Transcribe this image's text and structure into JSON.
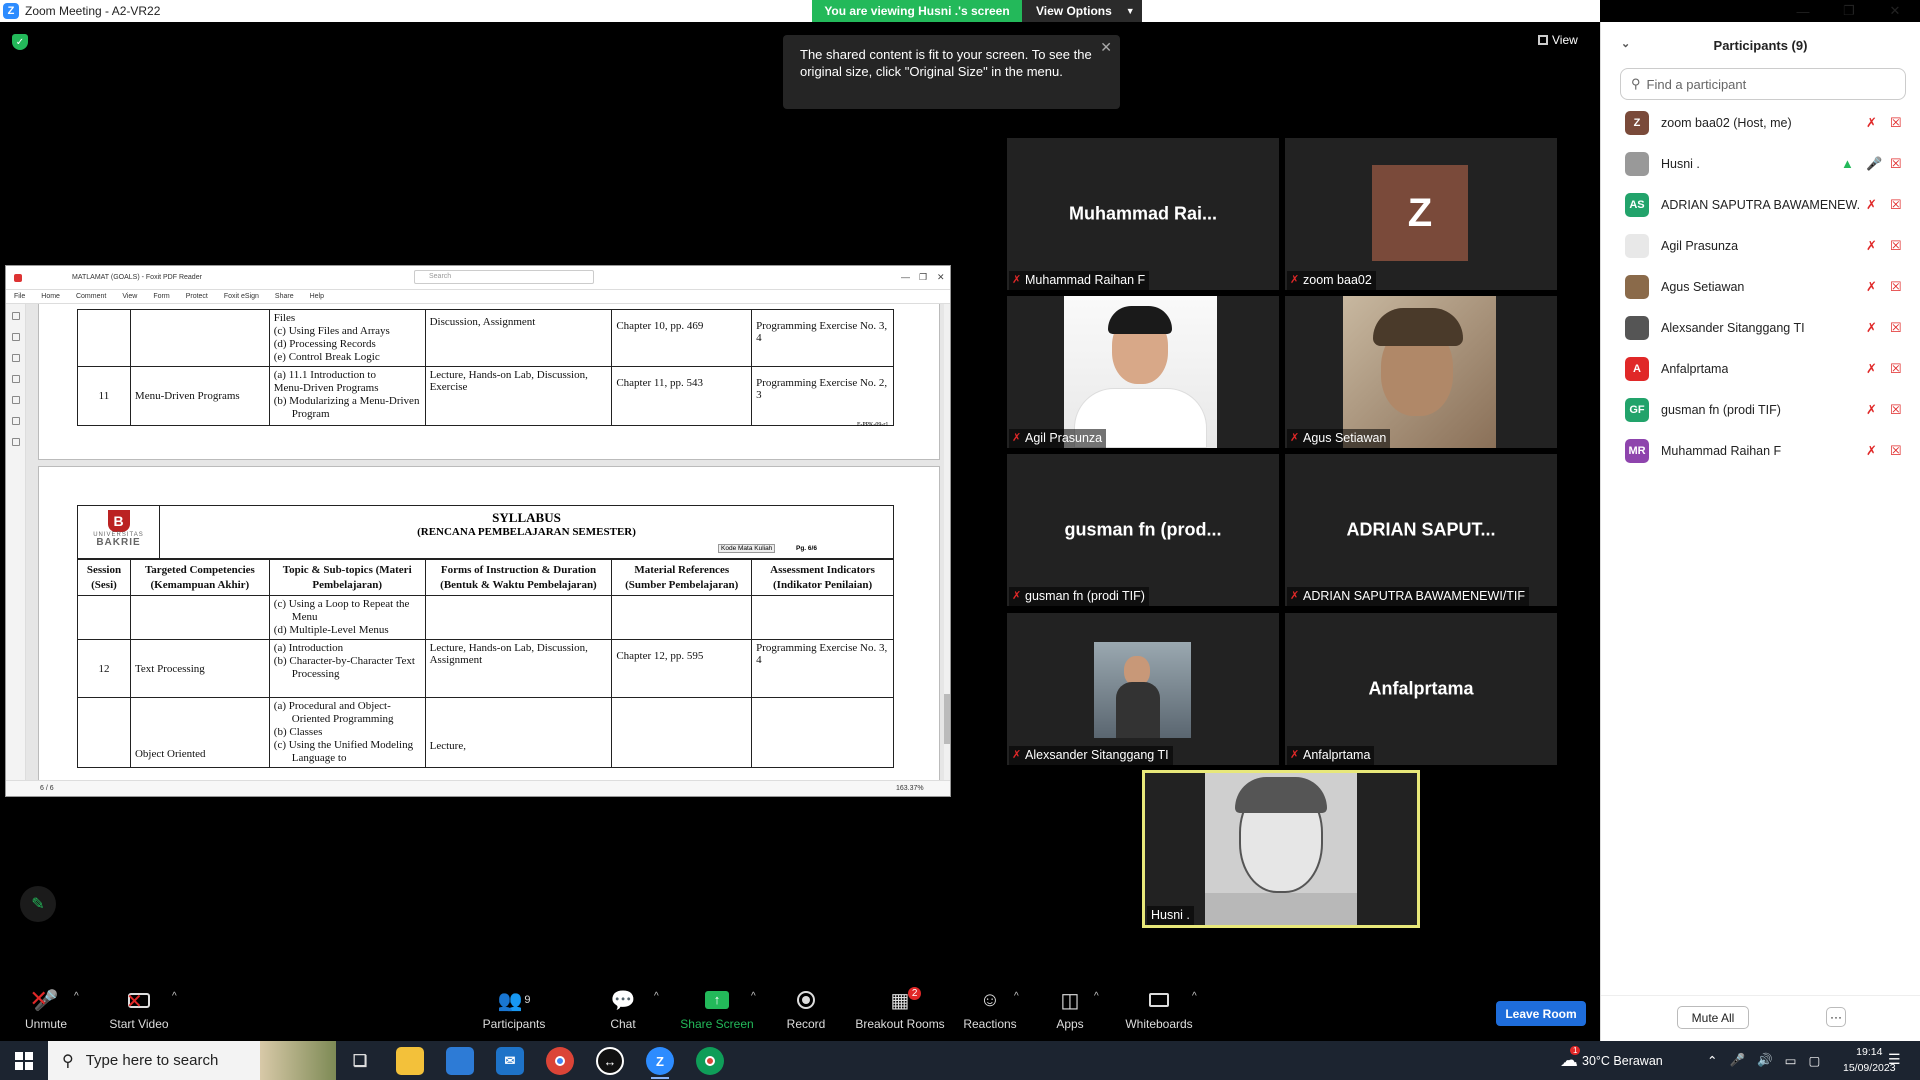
{
  "window": {
    "title": "Zoom Meeting - A2-VR22",
    "zoom_letter": "Z",
    "viewing_banner": "You are viewing Husni .'s screen",
    "view_options": "View Options",
    "tooltip_line1": "The shared content is fit to your screen. To see the",
    "tooltip_line2": "original size, click \"Original Size\" in the menu.",
    "view_label": "View"
  },
  "pdf": {
    "title": "MATLAMAT (GOALS) - Foxit PDF Reader",
    "search_placeholder": "Search",
    "menu": [
      "File",
      "Home",
      "Comment",
      "View",
      "Form",
      "Protect",
      "Foxit eSign",
      "Share",
      "Help"
    ],
    "top_rows": {
      "row10_topics": [
        "Files",
        "(c)  Using Files and Arrays",
        "(d)  Processing Records",
        "(e)  Control Break Logic"
      ],
      "row10_forms": "Discussion, Assignment",
      "row10_ref": "Chapter 10, pp. 469",
      "row10_assess": "Programming Exercise No. 3, 4",
      "row11_session": "11",
      "row11_comp": "Menu-Driven Programs",
      "row11_topics": [
        "(a)  11.1 Introduction to",
        "Menu-Driven Programs",
        "(b)  Modularizing a Menu-Driven Program"
      ],
      "row11_forms": "Lecture, Hands-on Lab, Discussion, Exercise",
      "row11_ref": "Chapter 11, pp. 543",
      "row11_assess": "Programming Exercise No. 2, 3",
      "form_code": "F-PPK-09-r1"
    },
    "page2": {
      "logo_letter": "B",
      "uni_small": "UNIVERSITAS",
      "uni_big": "BAKRIE",
      "title": "SYLLABUS",
      "subtitle": "(RENCANA PEMBELAJARAN SEMESTER)",
      "kode": "Kode Mata Kuliah",
      "page": "Pg. 6/6",
      "headers": [
        "Session (Sesi)",
        "Targeted Competencies (Kemampuan Akhir)",
        "Topic & Sub-topics (Materi Pembelajaran)",
        "Forms of Instruction & Duration (Bentuk & Waktu Pembelajaran)",
        "Material References (Sumber Pembelajaran)",
        "Assessment Indicators (Indikator Penilaian)"
      ],
      "row_a_topics": [
        "(c)  Using a Loop to Repeat the Menu",
        "(d)  Multiple-Level Menus"
      ],
      "row12_session": "12",
      "row12_comp": "Text Processing",
      "row12_topics": [
        "(a)  Introduction",
        "(b)  Character-by-Character Text Processing"
      ],
      "row12_forms": "Lecture, Hands-on Lab, Discussion, Assignment",
      "row12_ref": "Chapter 12, pp. 595",
      "row12_assess": "Programming Exercise No. 3, 4",
      "row13_comp": "Object Oriented",
      "row13_topics": [
        "(a)  Procedural and Object-Oriented Programming",
        "(b)  Classes",
        "(c)  Using the Unified Modeling Language to"
      ],
      "row13_forms": "Lecture,"
    },
    "status_page": "6 / 6",
    "status_zoom": "163.37%"
  },
  "tiles": [
    {
      "big": "Muhammad  Rai...",
      "name": "Muhammad Raihan F"
    },
    {
      "big": "Z",
      "name": "zoom baa02"
    },
    {
      "name": "Agil Prasunza"
    },
    {
      "name": "Agus Setiawan"
    },
    {
      "big": "gusman fn (prod...",
      "name": "gusman fn (prodi TIF)"
    },
    {
      "big": "ADRIAN  SAPUT...",
      "name": "ADRIAN SAPUTRA BAWAMENEWI/TIF"
    },
    {
      "name": "Alexsander Sitanggang TI"
    },
    {
      "big": "Anfalprtama",
      "name": "Anfalprtama"
    },
    {
      "name": "Husni ."
    }
  ],
  "toolbar": {
    "unmute": "Unmute",
    "start_video": "Start Video",
    "participants": "Participants",
    "participants_count": "9",
    "chat": "Chat",
    "share_screen": "Share Screen",
    "record": "Record",
    "breakout": "Breakout Rooms",
    "breakout_badge": "2",
    "reactions": "Reactions",
    "apps": "Apps",
    "whiteboards": "Whiteboards",
    "leave": "Leave Room"
  },
  "panel": {
    "title": "Participants (9)",
    "search_placeholder": "Find a participant",
    "participants": [
      {
        "initials": "Z",
        "name": "zoom baa02 (Host, me)",
        "color": "#7a4a3a"
      },
      {
        "initials": "",
        "name": "Husni .",
        "color": "#888888"
      },
      {
        "initials": "AS",
        "name": "ADRIAN SAPUTRA BAWAMENEW...",
        "color": "#22a36b"
      },
      {
        "initials": "",
        "name": "Agil Prasunza",
        "color": "#d9d9d9"
      },
      {
        "initials": "",
        "name": "Agus Setiawan",
        "color": "#8a6a4a"
      },
      {
        "initials": "",
        "name": "Alexsander Sitanggang TI",
        "color": "#555555"
      },
      {
        "initials": "A",
        "name": "Anfalprtama",
        "color": "#e02828"
      },
      {
        "initials": "GF",
        "name": "gusman fn (prodi TIF)",
        "color": "#22a36b"
      },
      {
        "initials": "MR",
        "name": "Muhammad Raihan F",
        "color": "#8e44ad"
      }
    ],
    "mute_all": "Mute All",
    "more": "···"
  },
  "taskbar": {
    "search_text": "Type here to search",
    "weather": "30°C  Berawan",
    "time": "19:14",
    "date": "15/09/2023",
    "notif_badge": "1"
  }
}
